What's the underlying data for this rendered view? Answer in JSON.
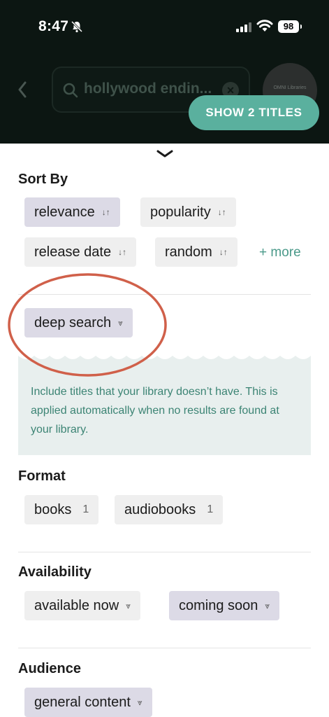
{
  "status_bar": {
    "time": "8:47",
    "battery": "98"
  },
  "header": {
    "search_text": "hollywood endin...",
    "library_name": "OMNI Libraries",
    "show_button": "SHOW 2 TITLES"
  },
  "sort_by": {
    "title": "Sort By",
    "options": [
      {
        "label": "relevance",
        "icon": "sort-arrows-icon",
        "active": true
      },
      {
        "label": "popularity",
        "icon": "sort-arrows-icon",
        "active": false
      },
      {
        "label": "release date",
        "icon": "sort-arrows-icon",
        "active": false
      },
      {
        "label": "random",
        "icon": "sort-arrows-icon",
        "active": false
      }
    ],
    "more_label": "+ more"
  },
  "deep_search": {
    "label": "deep search",
    "icon": "filter-icon",
    "active": true,
    "description": "Include titles that your library doesn’t have. This is applied automatically when no results are found at your library."
  },
  "format": {
    "title": "Format",
    "options": [
      {
        "label": "books",
        "count": "1"
      },
      {
        "label": "audiobooks",
        "count": "1"
      }
    ]
  },
  "availability": {
    "title": "Availability",
    "options": [
      {
        "label": "available now",
        "icon": "filter-icon",
        "active": false
      },
      {
        "label": "coming soon",
        "icon": "filter-icon",
        "active": true
      }
    ]
  },
  "audience": {
    "title": "Audience",
    "options": [
      {
        "label": "general content",
        "icon": "filter-icon",
        "active": true
      }
    ]
  },
  "colors": {
    "header_bg": "#0c1612",
    "accent": "#5ab09e",
    "active_chip": "#dcdae6",
    "chip": "#efefef",
    "info_text": "#3c8474",
    "annotation_oval": "#d0604a"
  }
}
